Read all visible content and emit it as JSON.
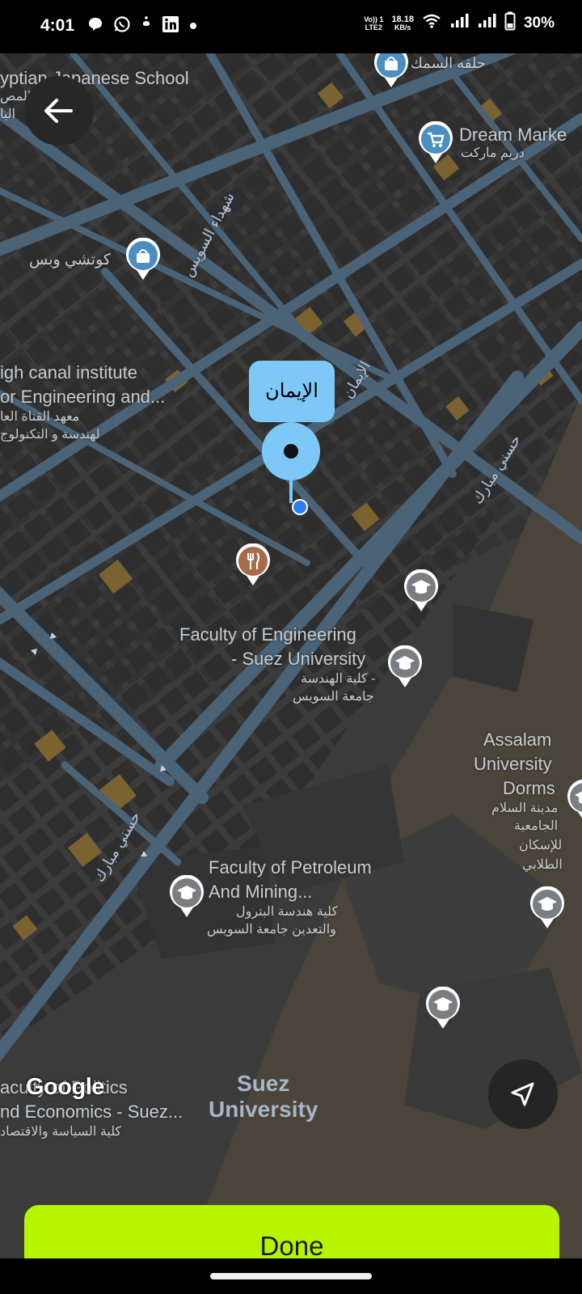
{
  "status_bar": {
    "time": "4:01",
    "network_type": "LTE2",
    "volte_label": "Vo)) 1",
    "speed_value": "18.18",
    "speed_unit": "KB/s",
    "battery": "30%",
    "left_icons": [
      "chat-icon",
      "whatsapp-icon",
      "khaleej-icon",
      "linkedin-icon",
      "dot-icon"
    ],
    "right_icons": [
      "wifi-icon",
      "signal-icon",
      "signal-icon",
      "battery-icon"
    ]
  },
  "map": {
    "labels": {
      "japanese_school": "yptian Japanese School",
      "dream_market_en": "Dream Marke",
      "dream_market_ar": "دريم ماركت",
      "fish_ring": "حلقه السمك",
      "kotshi": "كوتشي وبس",
      "canal_en_1": "igh canal institute",
      "canal_en_2": "or Engineering and...",
      "canal_ar_1": "معهد القناة العا",
      "canal_ar_2": "لهندسة و التكنولوج",
      "eng_en_1": "Faculty of Engineering",
      "eng_en_2": "- Suez University",
      "eng_ar_1": "كلية الهندسة -",
      "eng_ar_2": "جامعة السويس",
      "assalam_en_1": "Assalam",
      "assalam_en_2": "University",
      "assalam_en_3": "Dorms",
      "assalam_ar_1": "مدينة السلام",
      "assalam_ar_2": "الجامعية",
      "assalam_ar_3": "للإسكان",
      "assalam_ar_4": "الطلابي",
      "petroleum_en_1": "Faculty of Petroleum",
      "petroleum_en_2": "And Mining...",
      "petroleum_ar_1": "كلية هندسة البترول",
      "petroleum_ar_2": "والتعدين جامعة السويس",
      "politics_en_1": "aculty of Politics",
      "politics_en_2": "nd Economics -  Suez...",
      "politics_ar_1": "كلية السياسة والاقتصاد",
      "suez_university_1": "Suez",
      "suez_university_2": "University",
      "school_ar_1": "ية المص",
      "school_ar_2": "اليا"
    },
    "roads": {
      "shohada": "شهداء السويس",
      "eliman": "الإيمان",
      "hosny_1": "حسني مبارك",
      "hosny_2": "حسني مبارك"
    },
    "selected_place": "الإيمان",
    "attribution": "Google"
  },
  "colors": {
    "accent": "#b7f400",
    "marker": "#7ec8f8",
    "map_bg": "#3b3b3b",
    "road": "#4a6377",
    "poi_blue": "#4a8fc0",
    "poi_grey": "#7a7e82",
    "poi_food": "#a86b4a"
  },
  "buttons": {
    "back_icon": "arrow-left-icon",
    "locate_icon": "navigation-arrow-icon",
    "done_label": "Done"
  }
}
